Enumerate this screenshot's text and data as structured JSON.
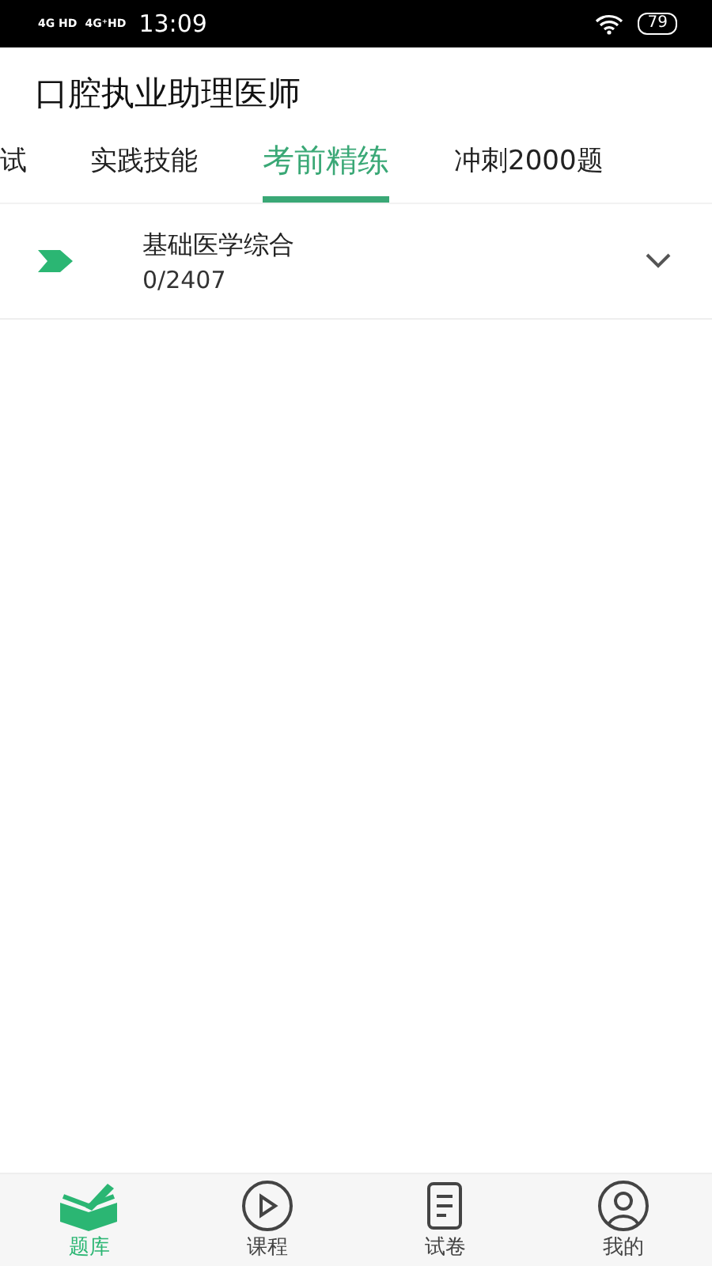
{
  "status_bar": {
    "network_1": "4G HD",
    "network_2": "4G⁺HD",
    "time": "13:09",
    "battery": "79"
  },
  "header": {
    "title": "口腔执业助理医师"
  },
  "tabs": [
    {
      "label": "试",
      "selected": false
    },
    {
      "label": "实践技能",
      "selected": false
    },
    {
      "label": "考前精练",
      "selected": true
    },
    {
      "label": "冲刺2000题",
      "selected": false
    }
  ],
  "chapters": [
    {
      "title": "基础医学综合",
      "progress": "0/2407",
      "expanded": false
    }
  ],
  "bottom_nav": [
    {
      "label": "题库",
      "kind": "book",
      "selected": true
    },
    {
      "label": "课程",
      "kind": "play",
      "selected": false
    },
    {
      "label": "试卷",
      "kind": "paper",
      "selected": false
    },
    {
      "label": "我的",
      "kind": "person",
      "selected": false
    }
  ]
}
